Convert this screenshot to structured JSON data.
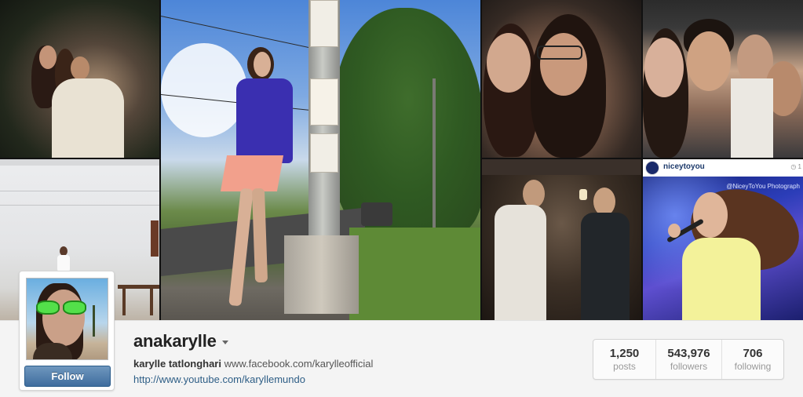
{
  "profile": {
    "username": "anakarylle",
    "full_name": "karylle tatlonghari",
    "bio_link": "www.facebook.com/karylleofficial",
    "website": "http://www.youtube.com/karyllemundo",
    "follow_label": "Follow"
  },
  "stats": [
    {
      "value": "1,250",
      "label": "posts"
    },
    {
      "value": "543,976",
      "label": "followers"
    },
    {
      "value": "706",
      "label": "following"
    }
  ],
  "mosaic": {
    "tile7_username": "niceytoyou",
    "tile7_time": "1",
    "tile7_watermark": "@NiceyToYou Photograph"
  },
  "colors": {
    "follow_button": "#3f6d9e",
    "link": "#2e5e86",
    "page_bg": "#f4f4f4"
  }
}
